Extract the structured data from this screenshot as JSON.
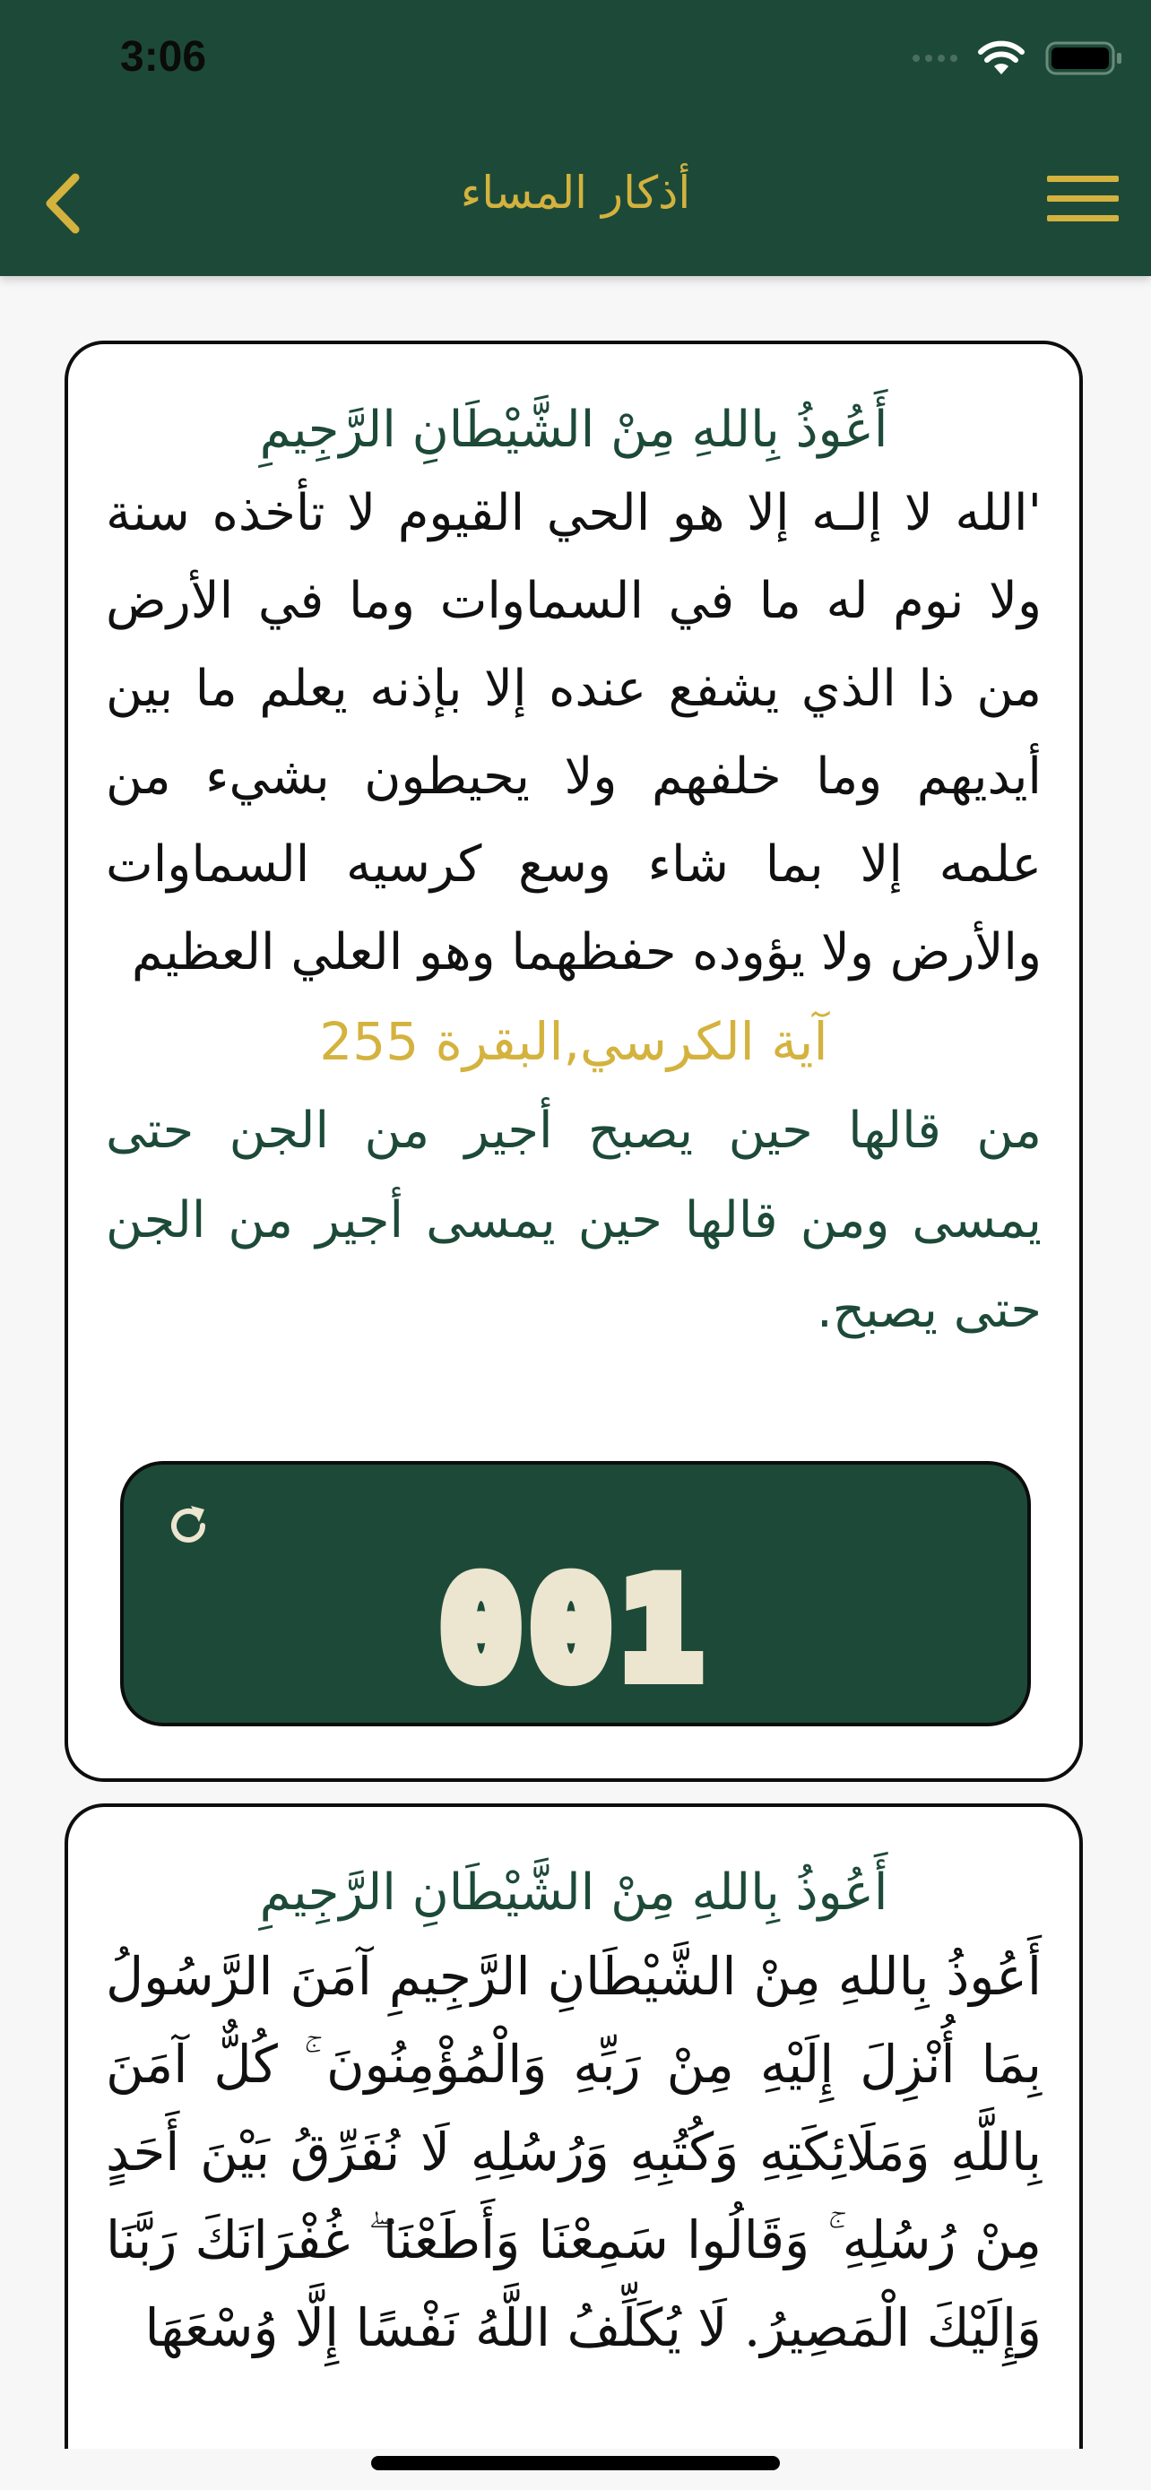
{
  "status_bar": {
    "time": "3:06"
  },
  "header": {
    "title": "أذكار المساء"
  },
  "cards": [
    {
      "isti3adha": "أَعُوذُ بِاللهِ مِنْ الشَّيْطَانِ الرَّجِيمِ",
      "text": "'الله لا إلـه إلا هو الحي القيوم لا تأخذه سنة ولا نوم له ما في السماوات وما في الأرض من ذا الذي يشفع عنده إلا بإذنه يعلم ما بين أيديهم وما خلفهم ولا يحيطون بشيء من علمه إلا بما شاء وسع كرسيه السماوات والأرض ولا يؤوده حفظهما وهو العلي العظيم",
      "reference": "آية الكرسي,البقرة 255",
      "virtue": "من قالها حين يصبح أجير من الجن حتى يمسى ومن قالها حين يمسى أجير من الجن حتى يصبح.",
      "counter": "001"
    },
    {
      "isti3adha": "أَعُوذُ بِاللهِ مِنْ الشَّيْطَانِ الرَّجِيمِ",
      "text": "أَعُوذُ بِاللهِ مِنْ الشَّيْطَانِ الرَّجِيمِ آمَنَ الرَّسُولُ بِمَا أُنْزِلَ إِلَيْهِ مِنْ رَبِّهِ وَالْمُؤْمِنُونَ ۚ كُلٌّ آمَنَ بِاللَّهِ وَمَلَائِكَتِهِ وَكُتُبِهِ وَرُسُلِهِ لَا نُفَرِّقُ بَيْنَ أَحَدٍ مِنْ رُسُلِهِ ۚ وَقَالُوا سَمِعْنَا وَأَطَعْنَا ۖ غُفْرَانَكَ رَبَّنَا وَإِلَيْكَ الْمَصِيرُ. لَا يُكَلِّفُ اللَّهُ نَفْسًا إِلَّا وُسْعَهَا"
    }
  ],
  "colors": {
    "header_bg": "#1d4a38",
    "accent_gold": "#d4b23e",
    "counter_digits": "#ece5cf"
  },
  "icons": {
    "back": "chevron-left-icon",
    "menu": "hamburger-menu-icon",
    "reset": "refresh-icon"
  }
}
